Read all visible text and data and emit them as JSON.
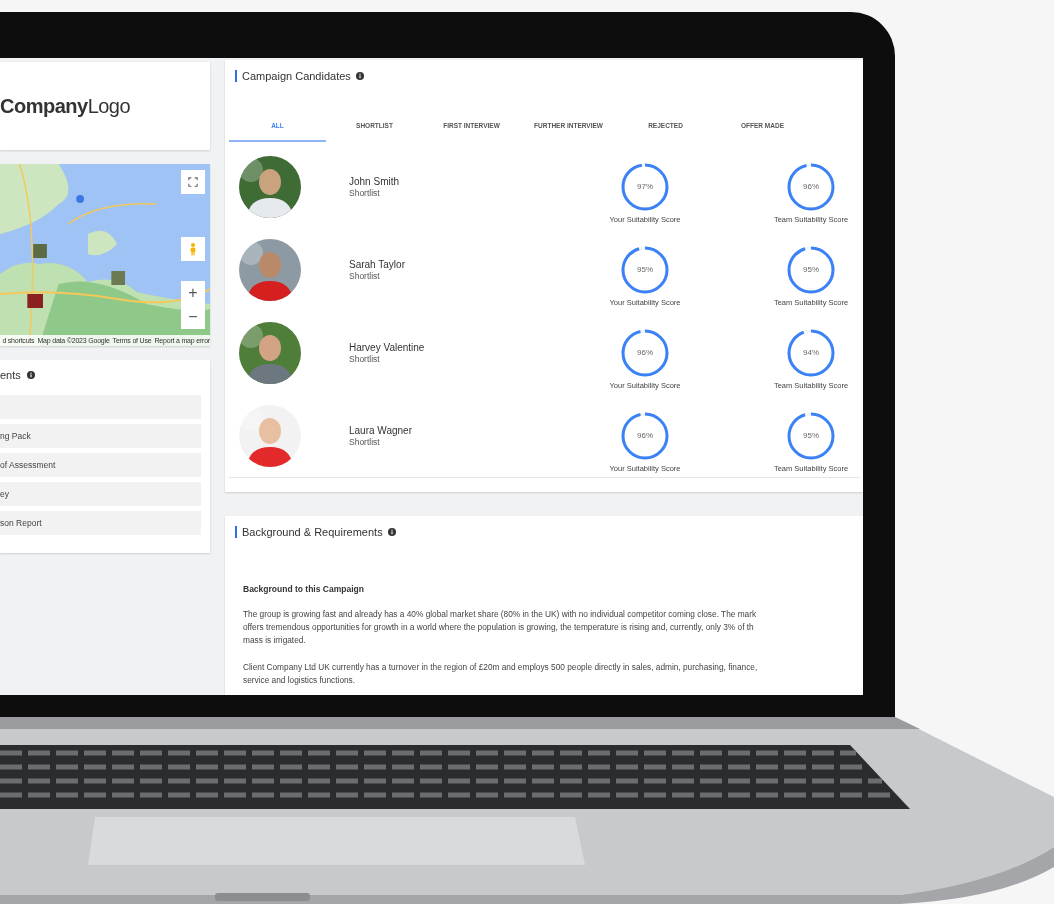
{
  "logo": {
    "text": "**Company**Logo"
  },
  "map": {
    "kind": "picture",
    "zoom_in": "+",
    "zoom_out": "−",
    "attribution": [
      "d shortcuts",
      "Map data ©2023 Google",
      "Terms of Use",
      "Report a map error"
    ]
  },
  "documents": {
    "title": "ents",
    "items": [
      {
        "label": "ng Pack"
      },
      {
        "label": "of Assessment"
      },
      {
        "label": "ey"
      },
      {
        "label": "son Report"
      }
    ]
  },
  "candidates": {
    "title": "Campaign Candidates",
    "tabs": [
      {
        "label": "ALL",
        "selected": true
      },
      {
        "label": "SHORTLIST",
        "selected": false
      },
      {
        "label": "FIRST INTERVIEW",
        "selected": false
      },
      {
        "label": "FURTHER INTERVIEW",
        "selected": false
      },
      {
        "label": "REJECTED",
        "selected": false
      },
      {
        "label": "OFFER MADE",
        "selected": false
      }
    ],
    "rows": [
      {
        "name": "John Smith",
        "status": "Shortlist",
        "scores": [
          {
            "level": 0.97,
            "reading": "97%",
            "label": "Your Suitability Score"
          },
          {
            "level": 0.96,
            "reading": "96%",
            "label": "Team Suitability Score"
          }
        ]
      },
      {
        "name": "Sarah Taylor",
        "status": "Shortlist",
        "scores": [
          {
            "level": 0.95,
            "reading": "95%",
            "label": "Your Suitability Score"
          },
          {
            "level": 0.95,
            "reading": "95%",
            "label": "Team Suitability Score"
          }
        ]
      },
      {
        "name": "Harvey Valentine",
        "status": "Shortlist",
        "scores": [
          {
            "level": 0.96,
            "reading": "96%",
            "label": "Your Suitability Score"
          },
          {
            "level": 0.94,
            "reading": "94%",
            "label": "Team Suitability Score"
          }
        ]
      },
      {
        "name": "Laura Wagner",
        "status": "Shortlist",
        "scores": [
          {
            "level": 0.96,
            "reading": "96%",
            "label": "Your Suitability Score"
          },
          {
            "level": 0.95,
            "reading": "95%",
            "label": "Team Suitability Score"
          }
        ]
      }
    ]
  },
  "background": {
    "title": "Background & Requirements",
    "subtitle": "Background to this Campaign",
    "paragraphs": [
      {
        "lines": [
          "The group is growing fast and already has a 40% global market share (80% in the UK) with no individual competitor coming close. The mark",
          "offers tremendous opportunities for growth in a world where the population is growing, the temperature is rising and, currently, only 3% of th",
          "mass is irrigated."
        ]
      },
      {
        "lines": [
          "Client Company Ltd UK currently has a turnover in the region of £20m and employs 500 people directly in sales, admin, purchasing, finance,",
          "service and logistics functions."
        ]
      }
    ]
  }
}
